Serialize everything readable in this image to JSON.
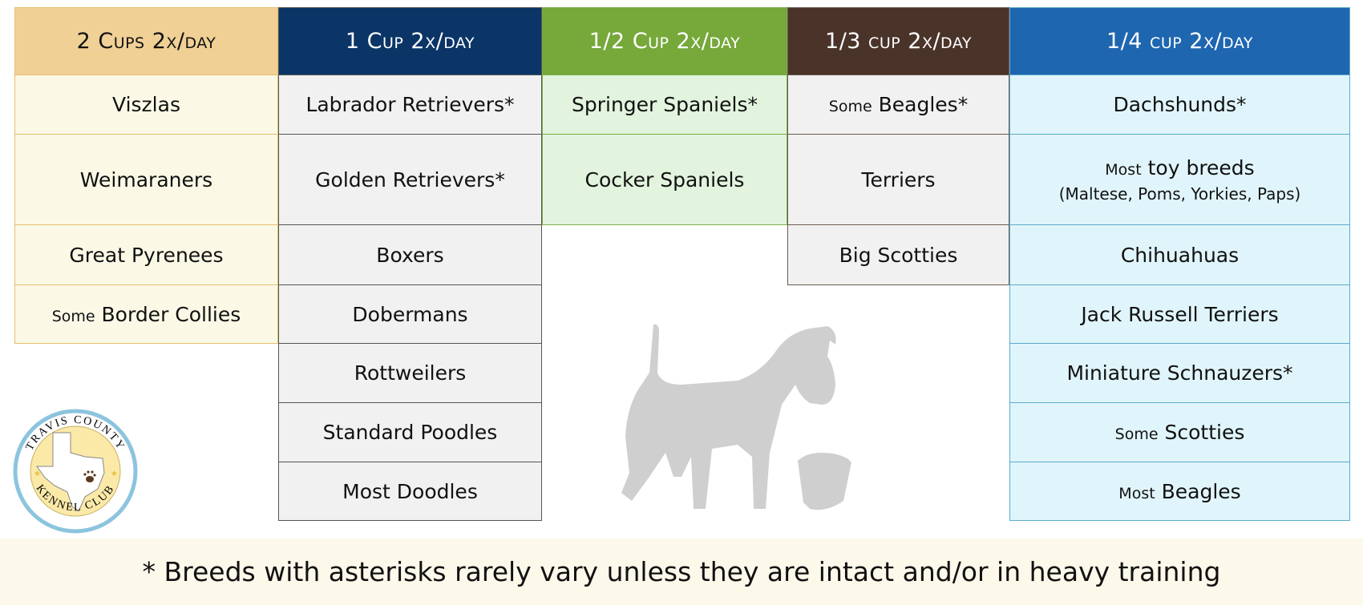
{
  "columns": [
    {
      "header": "2 Cups 2x/day",
      "colors": {
        "header_bg": "#f0d095",
        "header_fg": "#111111",
        "cell_bg": "#fbf9e6",
        "border": "#e6be6e"
      },
      "cells": [
        {
          "prefix": "",
          "name": "Viszlas"
        },
        {
          "prefix": "",
          "name": "Weimaraners"
        },
        {
          "prefix": "",
          "name": "Great Pyrenees"
        },
        {
          "prefix": "Some",
          "name": "Border Collies"
        }
      ]
    },
    {
      "header": "1 Cup 2x/day",
      "colors": {
        "header_bg": "#0b3566",
        "header_fg": "#ffffff",
        "cell_bg": "#f1f1f1",
        "border": "#555555"
      },
      "cells": [
        {
          "prefix": "",
          "name": "Labrador Retrievers*"
        },
        {
          "prefix": "",
          "name": "Golden Retrievers*"
        },
        {
          "prefix": "",
          "name": "Boxers"
        },
        {
          "prefix": "",
          "name": "Dobermans"
        },
        {
          "prefix": "",
          "name": "Rottweilers"
        },
        {
          "prefix": "",
          "name": "Standard Poodles"
        },
        {
          "prefix": "",
          "name": "Most Doodles"
        }
      ]
    },
    {
      "header": "1/2 Cup 2x/day",
      "colors": {
        "header_bg": "#76a83a",
        "header_fg": "#ffffff",
        "cell_bg": "#e2f4de",
        "border": "#7aae4a"
      },
      "cells": [
        {
          "prefix": "",
          "name": "Springer Spaniels*"
        },
        {
          "prefix": "",
          "name": "Cocker Spaniels"
        }
      ]
    },
    {
      "header": "1/3 cup 2x/day",
      "colors": {
        "header_bg": "#4a3429",
        "header_fg": "#ffffff",
        "cell_bg": "#f1f1f1",
        "border": "#6b5a50"
      },
      "cells": [
        {
          "prefix": "Some",
          "name": "Beagles*"
        },
        {
          "prefix": "",
          "name": "Terriers"
        },
        {
          "prefix": "",
          "name": "Big Scotties"
        }
      ]
    },
    {
      "header": "1/4 cup 2x/day",
      "colors": {
        "header_bg": "#1e66b0",
        "header_fg": "#ffffff",
        "cell_bg": "#e0f5fb",
        "border": "#5aaccc"
      },
      "cells": [
        {
          "prefix": "",
          "name": "Dachshunds*"
        },
        {
          "prefix": "Most",
          "name": "toy breeds",
          "sub": "(Maltese, Poms, Yorkies, Paps)"
        },
        {
          "prefix": "",
          "name": "Chihuahuas"
        },
        {
          "prefix": "",
          "name": "Jack Russell Terriers"
        },
        {
          "prefix": "",
          "name": "Miniature Schnauzers*"
        },
        {
          "prefix": "Some",
          "name": "Scotties"
        },
        {
          "prefix": "Most",
          "name": "Beagles"
        }
      ]
    }
  ],
  "logo": {
    "top_text": "TRAVIS COUNTY",
    "bottom_text": "KENNEL CLUB"
  },
  "footer": "* Breeds with asterisks rarely vary unless they are intact and/or in heavy training"
}
